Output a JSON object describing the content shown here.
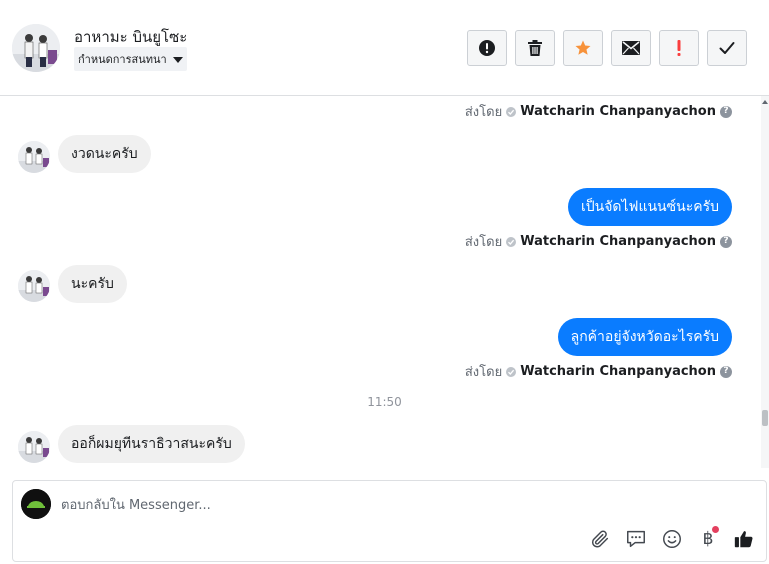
{
  "header": {
    "contact_name": "อาหามะ บินยูโซะ",
    "label_dropdown": "กำหนดการสนทนา"
  },
  "actions": [
    {
      "icon": "alert-circle-icon",
      "color": "#1c1e21"
    },
    {
      "icon": "trash-icon",
      "color": "#1c1e21"
    },
    {
      "icon": "star-icon",
      "color": "#f7923b"
    },
    {
      "icon": "envelope-icon",
      "color": "#1c1e21"
    },
    {
      "icon": "exclamation-icon",
      "color": "#fa3e3e"
    },
    {
      "icon": "checkmark-icon",
      "color": "#1c1e21"
    }
  ],
  "thread": {
    "sent_by_prefix": "ส่งโดย",
    "sender_name": "Watcharin Chanpanyachon",
    "help_mark": "?",
    "timestamp": "11:50",
    "messages": [
      {
        "direction": "in",
        "text": "งวดนะครับ"
      },
      {
        "direction": "out",
        "text": "เป็นจัดไฟแนนซ์นะครับ"
      },
      {
        "direction": "in",
        "text": "นะครับ"
      },
      {
        "direction": "out",
        "text": "ลูกค้าอยู่จังหวัดอะไรครับ"
      },
      {
        "direction": "in",
        "text": "ออก็ผมยุทีนราธิวาสนะครับ"
      }
    ]
  },
  "composer": {
    "placeholder": "ตอบกลับใน Messenger...",
    "baht_symbol": "฿"
  },
  "colors": {
    "outgoing_bubble": "#0a7cff",
    "incoming_bubble": "#f0f0f0",
    "star": "#f7923b",
    "flag": "#fa3e3e",
    "notification_dot": "#e4405f"
  }
}
